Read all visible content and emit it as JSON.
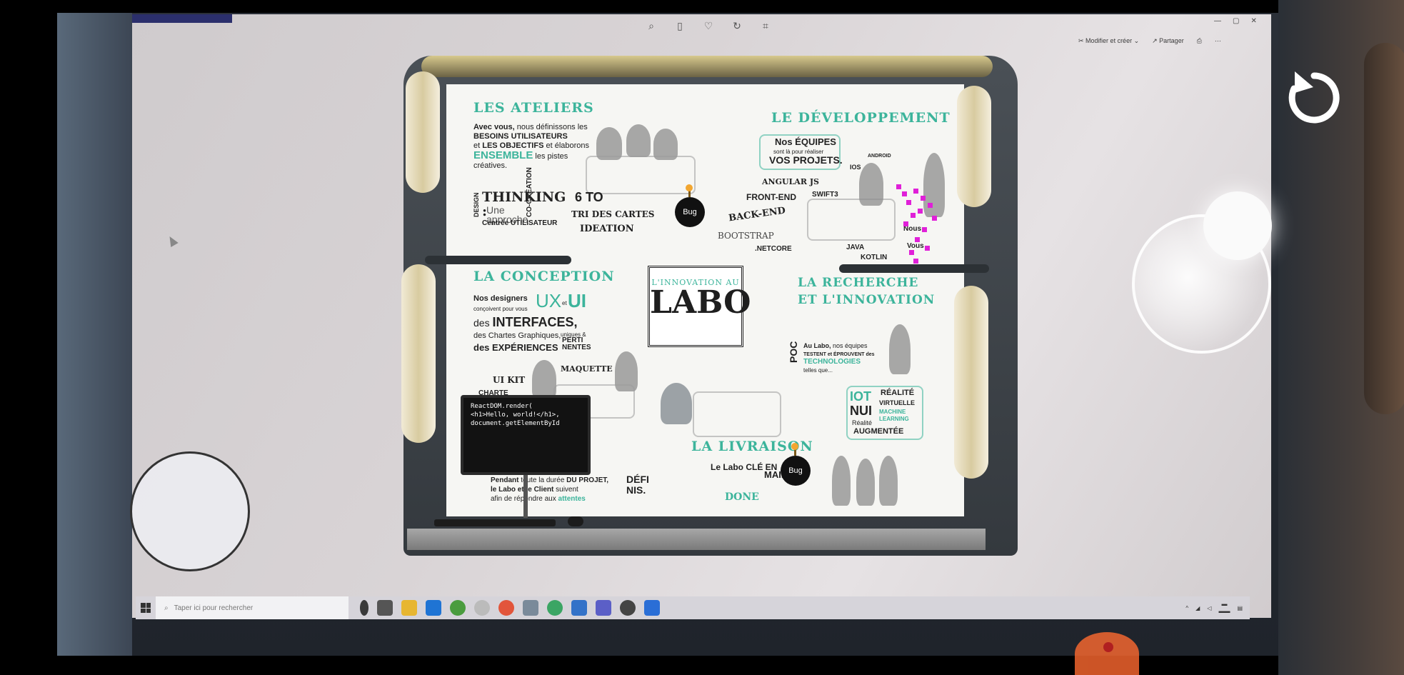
{
  "viewer": {
    "edit_label": "Modifier et créer",
    "share_label": "Partager"
  },
  "taskbar": {
    "search_placeholder": "Taper ici pour rechercher"
  },
  "board": {
    "ateliers": {
      "title": "LES ATELIERS",
      "line1a": "Avec vous,",
      "line1b": " nous définissons les",
      "line2": "BESOINS UTILISATEURS",
      "line3a": "et ",
      "line3b": "LES OBJECTIFS",
      "line3c": " et élaborons",
      "line4a": "ENSEMBLE",
      "line4b": " les pistes créatives.",
      "design": "DESIGN",
      "thinking": "THINKING :",
      "approche": "Une approche",
      "centree": "Centrée UTILISATEUR",
      "cocreation": "CO-CRÉATION",
      "six": "6 TO",
      "tri": "TRI DES CARTES",
      "ideation": "IDEATION"
    },
    "dev": {
      "title": "LE DÉVELOPPEMENT",
      "equipes": "Nos ÉQUIPES",
      "realiser": "sont là pour réaliser",
      "projets": "VOS PROJETS.",
      "ios": "IOS",
      "android": "ANDROID",
      "angular": "ANGULAR JS",
      "frontend": "FRONT-END",
      "swift": "SWIFT3",
      "backend": "BACK-END",
      "bootstrap": "BOOTSTRAP",
      "netcore": ".NETCORE",
      "java": "JAVA",
      "kotlin": "KOTLIN",
      "nous": "Nous",
      "vous": "Vous"
    },
    "conception": {
      "title": "LA CONCEPTION",
      "designers": "Nos designers",
      "concoivent": "conçoivent pour vous",
      "ux": "UX",
      "et": "et",
      "ui": "UI",
      "des": "des ",
      "interfaces": "INTERFACES,",
      "chartes": "des Chartes Graphiques,",
      "uniques": "uniques &",
      "pertinentes": "PERTI NENTES",
      "experiences": "des EXPÉRIENCES",
      "uikit": "UI KIT",
      "charte": "CHARTE",
      "maquette": "MAQUETTE"
    },
    "labo": {
      "small": "L'INNOVATION AU",
      "main": "LABO"
    },
    "recherche": {
      "title1": "LA RECHERCHE",
      "title2": "ET L'INNOVATION",
      "poc": "POC",
      "au_labo": "Au Labo,",
      "nos_equipes": " nos équipes",
      "testent": "TESTENT et ÉPROUVENT des",
      "techno": "TECHNOLOGIES",
      "telles": "telles que...",
      "iot": "IOT",
      "nui": "NUI",
      "realite": "RÉALITÉ",
      "virtuelle": "VIRTUELLE",
      "machine": "MACHINE",
      "learning": "LEARNING",
      "realite2": "Réalité",
      "augmentee": "AUGMENTÉE"
    },
    "livraison": {
      "title": "LA LIVRAISON",
      "labo": "Le Labo ",
      "cle": "CLÉ EN",
      "main": "MAIN",
      "pendant": "Pendant",
      "toute": " toute la durée ",
      "projet": "DU PROJET,",
      "client": "le Labo et le Client",
      "suivent": " suivent",
      "afin": "afin de répondre aux ",
      "attentes": "attentes",
      "definis": "DÉFI NIS.",
      "done": "DONE"
    },
    "bug1": "Bug",
    "bug2": "Bug"
  },
  "monitor": {
    "code": "ReactDOM.render(\n<h1>Hello, world!</h1>,\ndocument.getElementById"
  },
  "icons": {
    "joystick": "joystick-icon",
    "reset": "reset-icon",
    "light": "light-control-icon"
  }
}
